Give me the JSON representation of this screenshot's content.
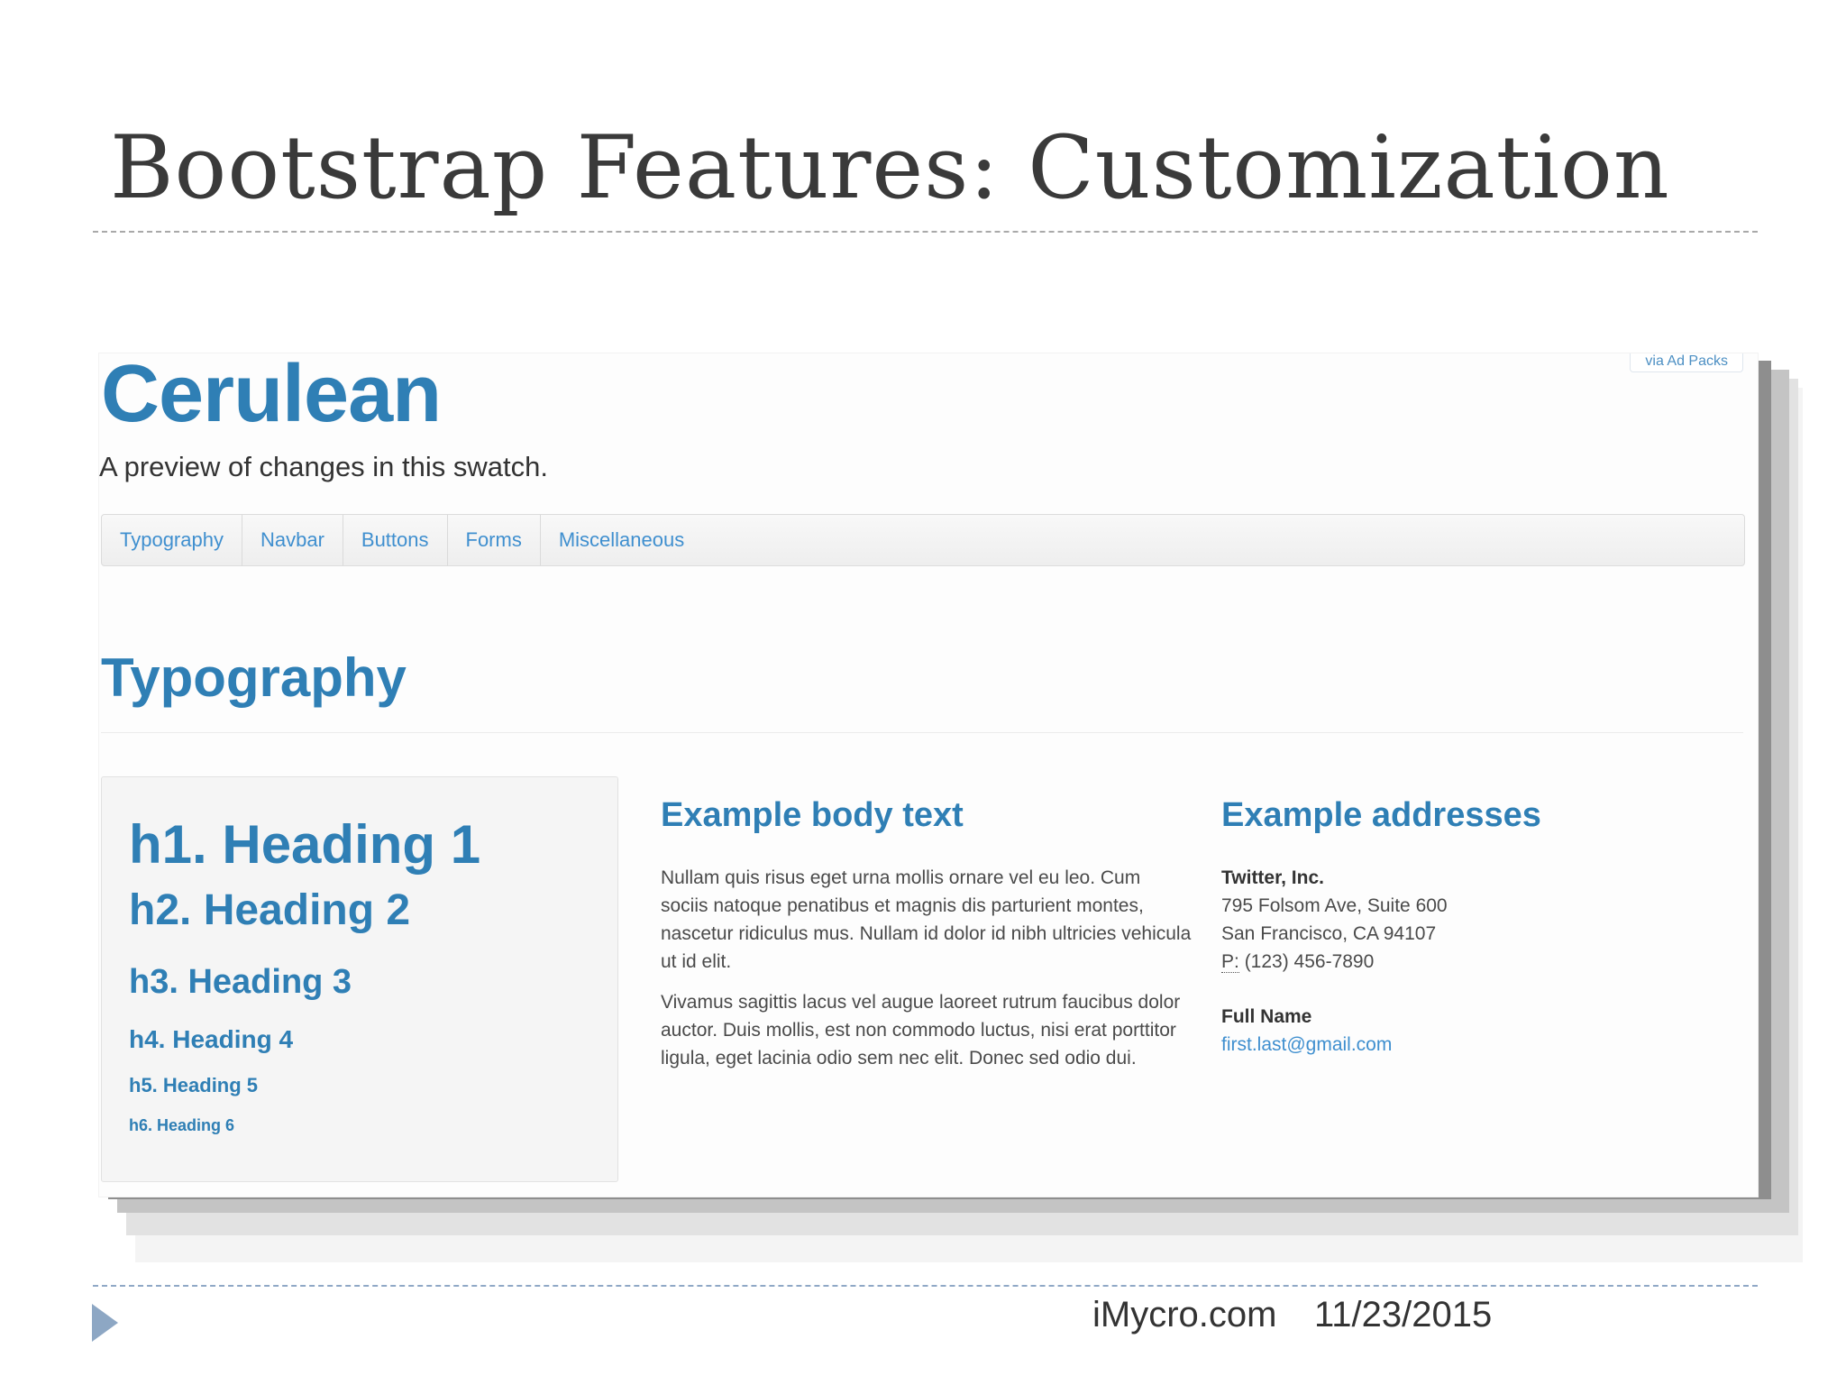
{
  "slide": {
    "title": "Bootstrap Features: Customization",
    "footer_site": "iMycro.com",
    "footer_date": "11/23/2015"
  },
  "preview": {
    "ad_tag": "via Ad Packs",
    "swatch_title": "Cerulean",
    "swatch_subtitle": "A preview of changes in this swatch.",
    "nav_items": [
      "Typography",
      "Navbar",
      "Buttons",
      "Forms",
      "Miscellaneous"
    ],
    "section_title": "Typography",
    "headings": [
      "h1. Heading 1",
      "h2. Heading 2",
      "h3. Heading 3",
      "h4. Heading 4",
      "h5. Heading 5",
      "h6. Heading 6"
    ],
    "body_title": "Example body text",
    "body_paragraphs": [
      "Nullam quis risus eget urna mollis ornare vel eu leo. Cum sociis natoque penatibus et magnis dis parturient montes, nascetur ridiculus mus. Nullam id dolor id nibh ultricies vehicula ut id elit.",
      "Vivamus sagittis lacus vel augue laoreet rutrum faucibus dolor auctor. Duis mollis, est non commodo luctus, nisi erat porttitor ligula, eget lacinia odio sem nec elit. Donec sed odio dui."
    ],
    "address_title": "Example addresses",
    "address1": {
      "name": "Twitter, Inc.",
      "street": "795 Folsom Ave, Suite 600",
      "city": "San Francisco, CA 94107",
      "phone_label": "P:",
      "phone": "(123) 456-7890"
    },
    "address2": {
      "name": "Full Name",
      "email": "first.last@gmail.com"
    }
  },
  "colors": {
    "brand_blue": "#2f7fb5",
    "link_blue": "#3f8fcf",
    "footer_arrow": "#8da7c4"
  }
}
